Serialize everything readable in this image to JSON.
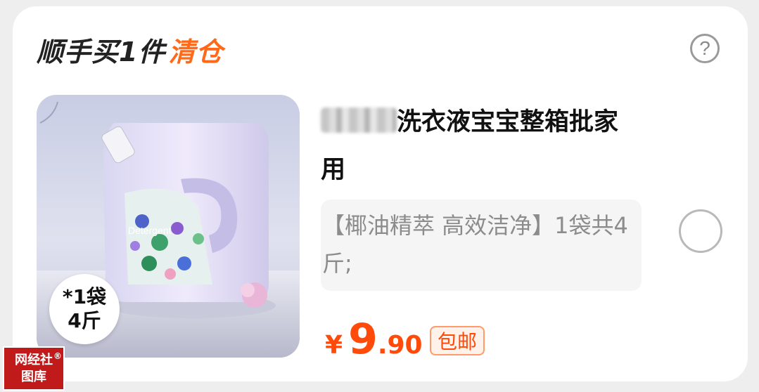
{
  "header": {
    "title_main": "顺手买1件",
    "title_accent": "清仓",
    "help_icon": "question-circle-icon",
    "help_symbol": "?"
  },
  "product": {
    "image_text": "Detergent",
    "badge_line1": "*1袋",
    "badge_line2": "4斤",
    "title": "洗衣液宝宝整箱批家用",
    "spec": "【椰油精萃 高效洁净】1袋共4斤;",
    "price_currency": "¥",
    "price_integer": "9",
    "price_decimal": ".90",
    "shipping_tag": "包邮"
  },
  "watermark": {
    "line1": "网经社",
    "line2": "图库",
    "reg": "®"
  },
  "colors": {
    "accent": "#ff6a1a",
    "price": "#ff4a0a",
    "background": "#eeeeee"
  }
}
